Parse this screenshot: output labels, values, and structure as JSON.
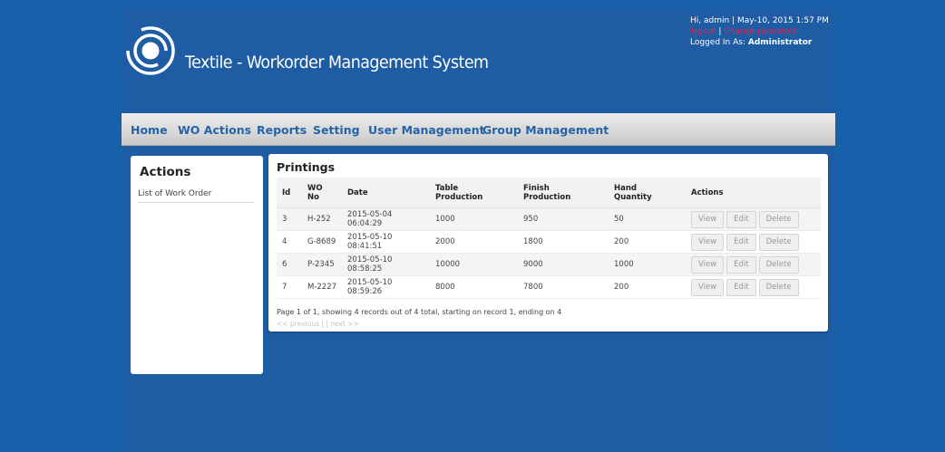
{
  "header": {
    "app_title": "Textile - Workorder Management System",
    "greeting": "Hi, admin | May-10, 2015 1:57 PM",
    "logout": "logout",
    "separator": " | ",
    "change_password": "Change password",
    "logged_in_prefix": "Logged In As: ",
    "role": "Administrator"
  },
  "nav": {
    "home": "Home",
    "wo_actions": "WO Actions",
    "reports": "Reports",
    "setting": "Setting",
    "user_management": "User Management",
    "group_management": "Group Management"
  },
  "sidebar": {
    "title": "Actions",
    "link": "List of Work Order"
  },
  "main": {
    "title": "Printings",
    "columns": {
      "id": "Id",
      "wo_no_line1": "WO",
      "wo_no_line2": "No",
      "date": "Date",
      "table_prod_line1": "Table",
      "table_prod_line2": "Production",
      "finish_prod_line1": "Finish",
      "finish_prod_line2": "Production",
      "hand_qty_line1": "Hand",
      "hand_qty_line2": "Quantity",
      "actions": "Actions"
    },
    "rows": [
      {
        "id": "3",
        "wo_no": "H-252",
        "date": "2015-05-04",
        "time": "06:04:29",
        "table_production": "1000",
        "finish_production": "950",
        "hand_quantity": "50"
      },
      {
        "id": "4",
        "wo_no": "G-8689",
        "date": "2015-05-10",
        "time": "08:41:51",
        "table_production": "2000",
        "finish_production": "1800",
        "hand_quantity": "200"
      },
      {
        "id": "6",
        "wo_no": "P-2345",
        "date": "2015-05-10",
        "time": "08:58:25",
        "table_production": "10000",
        "finish_production": "9000",
        "hand_quantity": "1000"
      },
      {
        "id": "7",
        "wo_no": "M-2227",
        "date": "2015-05-10",
        "time": "08:59:26",
        "table_production": "8000",
        "finish_production": "7800",
        "hand_quantity": "200"
      }
    ],
    "actions": {
      "view": "View",
      "edit": "Edit",
      "delete": "Delete"
    },
    "pager_summary": "Page 1 of 1, showing 4 records out of 4 total, starting on record 1, ending on 4",
    "pager_previous": "<< previous",
    "pager_separator": " |  | ",
    "pager_next": "next >>"
  },
  "colors": {
    "background": "#1761aa",
    "nav_link": "#2563a9",
    "logout_link": "#e8234f"
  }
}
